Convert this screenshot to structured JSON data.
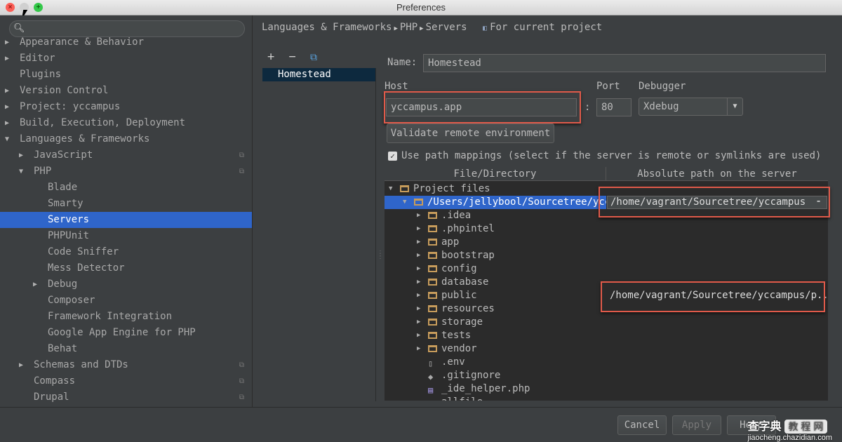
{
  "window": {
    "title": "Preferences"
  },
  "sidebar": {
    "search_placeholder": "",
    "items": [
      {
        "label": "Appearance & Behavior",
        "arrow": "▶",
        "level": 0,
        "shared": false
      },
      {
        "label": "Editor",
        "arrow": "▶",
        "level": 0,
        "shared": false
      },
      {
        "label": "Plugins",
        "arrow": "",
        "level": 0,
        "shared": false
      },
      {
        "label": "Version Control",
        "arrow": "▶",
        "level": 0,
        "shared": false
      },
      {
        "label": "Project: yccampus",
        "arrow": "▶",
        "level": 0,
        "shared": false
      },
      {
        "label": "Build, Execution, Deployment",
        "arrow": "▶",
        "level": 0,
        "shared": false
      },
      {
        "label": "Languages & Frameworks",
        "arrow": "▼",
        "level": 0,
        "shared": false
      },
      {
        "label": "JavaScript",
        "arrow": "▶",
        "level": 1,
        "shared": true
      },
      {
        "label": "PHP",
        "arrow": "▼",
        "level": 1,
        "shared": true
      },
      {
        "label": "Blade",
        "arrow": "",
        "level": 2,
        "shared": false
      },
      {
        "label": "Smarty",
        "arrow": "",
        "level": 2,
        "shared": false
      },
      {
        "label": "Servers",
        "arrow": "",
        "level": 2,
        "shared": false,
        "selected": true
      },
      {
        "label": "PHPUnit",
        "arrow": "",
        "level": 2,
        "shared": false
      },
      {
        "label": "Code Sniffer",
        "arrow": "",
        "level": 2,
        "shared": false
      },
      {
        "label": "Mess Detector",
        "arrow": "",
        "level": 2,
        "shared": false
      },
      {
        "label": "Debug",
        "arrow": "▶",
        "level": 2,
        "shared": false
      },
      {
        "label": "Composer",
        "arrow": "",
        "level": 2,
        "shared": false
      },
      {
        "label": "Framework Integration",
        "arrow": "",
        "level": 2,
        "shared": false
      },
      {
        "label": "Google App Engine for PHP",
        "arrow": "",
        "level": 2,
        "shared": false
      },
      {
        "label": "Behat",
        "arrow": "",
        "level": 2,
        "shared": false
      },
      {
        "label": "Schemas and DTDs",
        "arrow": "▶",
        "level": 1,
        "shared": true
      },
      {
        "label": "Compass",
        "arrow": "",
        "level": 1,
        "shared": true
      },
      {
        "label": "Drupal",
        "arrow": "",
        "level": 1,
        "shared": true
      }
    ]
  },
  "breadcrumb": {
    "parts": [
      "Languages & Frameworks",
      "PHP",
      "Servers"
    ],
    "scope": "For current project"
  },
  "servers": {
    "toolbar": {
      "add": "+",
      "remove": "−",
      "copy": "⧉"
    },
    "list": [
      "Homestead"
    ]
  },
  "form": {
    "name_label": "Name:",
    "name_value": "Homestead",
    "host_label": "Host",
    "host_value": "yccampus.app",
    "colon": ":",
    "port_label": "Port",
    "port_value": "80",
    "debugger_label": "Debugger",
    "debugger_value": "Xdebug",
    "validate_label": "Validate remote environment",
    "use_mappings_checked": true,
    "use_mappings_label": "Use path mappings (select if the server is remote or symlinks are used)"
  },
  "mappings": {
    "headers": [
      "File/Directory",
      "Absolute path on the server"
    ],
    "rows": [
      {
        "indent": 0,
        "arrow": "▼",
        "type": "folder",
        "name": "Project files",
        "server": ""
      },
      {
        "indent": 1,
        "arrow": "▼",
        "type": "folder",
        "name": "/Users/jellybool/Sourcetree/yccampus",
        "server": "/home/vagrant/Sourcetree/yccampus",
        "selected": true,
        "editing": true
      },
      {
        "indent": 2,
        "arrow": "▶",
        "type": "folder",
        "name": ".idea",
        "server": ""
      },
      {
        "indent": 2,
        "arrow": "▶",
        "type": "folder",
        "name": ".phpintel",
        "server": ""
      },
      {
        "indent": 2,
        "arrow": "▶",
        "type": "folder",
        "name": "app",
        "server": ""
      },
      {
        "indent": 2,
        "arrow": "▶",
        "type": "folder",
        "name": "bootstrap",
        "server": ""
      },
      {
        "indent": 2,
        "arrow": "▶",
        "type": "folder",
        "name": "config",
        "server": ""
      },
      {
        "indent": 2,
        "arrow": "▶",
        "type": "folder",
        "name": "database",
        "server": ""
      },
      {
        "indent": 2,
        "arrow": "▶",
        "type": "folder",
        "name": "public",
        "server": "/home/vagrant/Sourcetree/yccampus/p..."
      },
      {
        "indent": 2,
        "arrow": "▶",
        "type": "folder",
        "name": "resources",
        "server": ""
      },
      {
        "indent": 2,
        "arrow": "▶",
        "type": "folder",
        "name": "storage",
        "server": ""
      },
      {
        "indent": 2,
        "arrow": "▶",
        "type": "folder",
        "name": "tests",
        "server": ""
      },
      {
        "indent": 2,
        "arrow": "▶",
        "type": "folder",
        "name": "vendor",
        "server": ""
      },
      {
        "indent": 2,
        "arrow": "",
        "type": "file",
        "name": ".env",
        "server": ""
      },
      {
        "indent": 2,
        "arrow": "",
        "type": "git",
        "name": ".gitignore",
        "server": ""
      },
      {
        "indent": 2,
        "arrow": "",
        "type": "php",
        "name": "_ide_helper.php",
        "server": ""
      },
      {
        "indent": 2,
        "arrow": "",
        "type": "file",
        "name": "allfile",
        "server": ""
      }
    ]
  },
  "footer": {
    "cancel": "Cancel",
    "apply": "Apply",
    "help": "Help"
  },
  "watermark": {
    "brand": "查字典",
    "tag": "教 程 网",
    "url": "jiaocheng.chazidian.com"
  }
}
